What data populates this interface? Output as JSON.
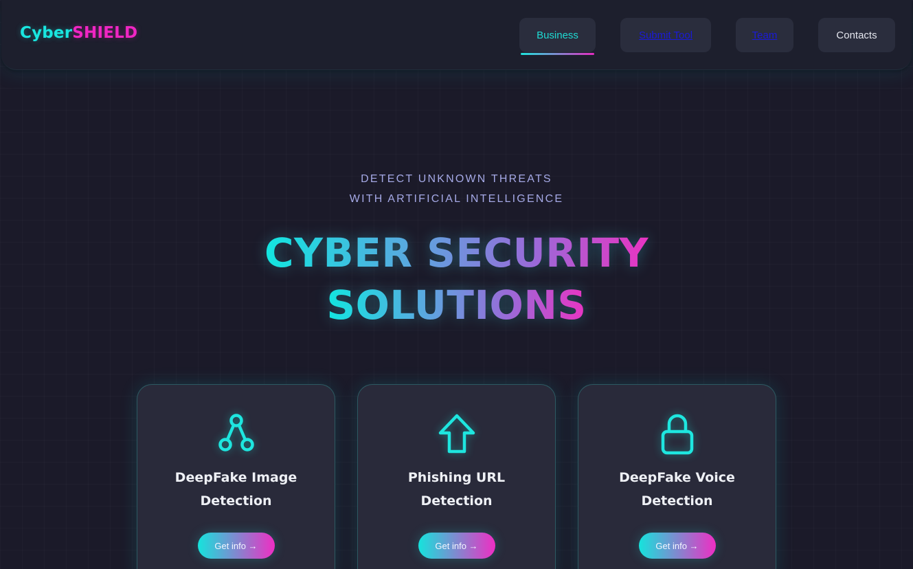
{
  "header": {
    "logo_part1": "Cyber",
    "logo_part2": "SHIELD",
    "nav": [
      {
        "label": "Business",
        "active": true
      },
      {
        "label": "Submit Tool"
      },
      {
        "label": "Team"
      },
      {
        "label": "Contacts"
      }
    ]
  },
  "hero": {
    "tagline_line1": "DETECT UNKNOWN THREATS",
    "tagline_line2": "WITH ARTIFICIAL INTELLIGENCE",
    "title_line1": "CYBER SECURITY",
    "title_line2": "SOLUTIONS"
  },
  "cards": [
    {
      "icon": "share-nodes-icon",
      "title_line1": "DeepFake Image",
      "title_line2": "Detection",
      "button": "Get info →"
    },
    {
      "icon": "arrow-up-icon",
      "title_line1": "Phishing URL",
      "title_line2": "Detection",
      "button": "Get info →"
    },
    {
      "icon": "lock-icon",
      "title_line1": "DeepFake Voice",
      "title_line2": "Detection",
      "button": "Get info →"
    }
  ],
  "colors": {
    "accent_cyan": "#19e6e0",
    "accent_magenta": "#f026c3",
    "background": "#1b1a29",
    "card": "#292a3a"
  }
}
